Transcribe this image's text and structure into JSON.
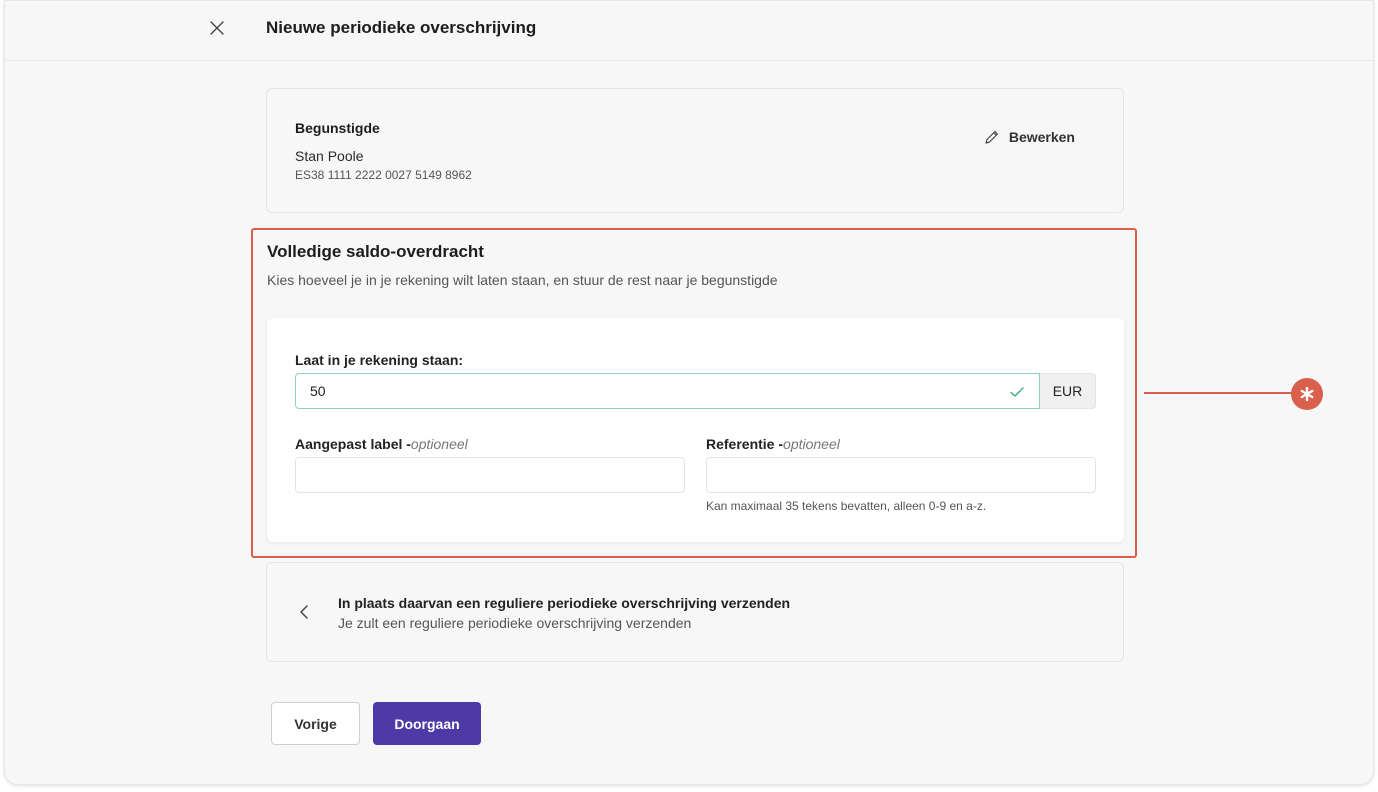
{
  "header": {
    "title": "Nieuwe periodieke overschrijving",
    "close_icon": "close-icon"
  },
  "beneficiary": {
    "heading": "Begunstigde",
    "name": "Stan Poole",
    "iban": "ES38 1111 2222 0027 5149 8962",
    "edit_label": "Bewerken",
    "edit_icon": "pencil-icon"
  },
  "full_transfer": {
    "title": "Volledige saldo-overdracht",
    "subtitle": "Kies hoeveel je in je rekening wilt laten staan, en stuur de rest naar je begunstigde",
    "amount_label": "Laat in je rekening staan:",
    "amount_value": "50",
    "currency": "EUR",
    "custom_label": "Aangepast label -",
    "custom_label_optional": "optioneel",
    "reference_label": "Referentie -",
    "reference_optional": "optioneel",
    "reference_hint": "Kan maximaal 35 tekens bevatten, alleen 0-9 en a-z."
  },
  "regular_option": {
    "title": "In plaats daarvan een reguliere periodieke overschrijving verzenden",
    "subtitle": "Je zult een reguliere periodieke overschrijving verzenden"
  },
  "actions": {
    "previous_label": "Vorige",
    "continue_label": "Doorgaan"
  },
  "colors": {
    "highlight": "#d9604c",
    "primary": "#4d3aa6",
    "valid": "#3bb07d"
  }
}
